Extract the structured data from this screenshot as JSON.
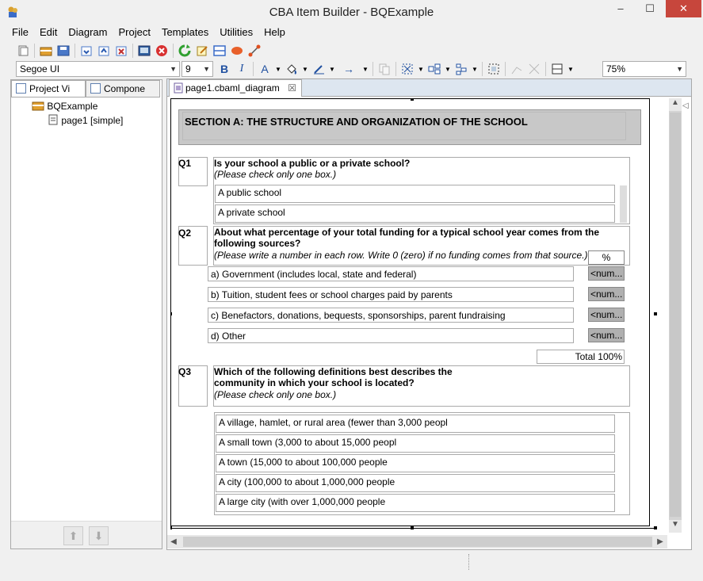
{
  "window": {
    "title": "CBA Item Builder - BQExample",
    "min": "–",
    "max": "☐",
    "close": "✕"
  },
  "menu": [
    "File",
    "Edit",
    "Diagram",
    "Project",
    "Templates",
    "Utilities",
    "Help"
  ],
  "toolbar": {
    "font": "Segoe UI",
    "size": "9",
    "bold": "B",
    "italic": "I",
    "font_color": "A",
    "arrow": "→",
    "zoom": "75%"
  },
  "left_panel": {
    "tabs": [
      "Project Vi",
      "Compone"
    ],
    "tree": {
      "project": "BQExample",
      "page": "page1 [simple]"
    }
  },
  "editor": {
    "tab": "page1.cbaml_diagram"
  },
  "form": {
    "section_title": "SECTION A: THE STRUCTURE AND ORGANIZATION OF THE SCHOOL",
    "q1": {
      "num": "Q1",
      "text": "Is your school a public or a private school?",
      "hint": "(Please check only one box.)",
      "options": [
        "A public school",
        "A private school"
      ]
    },
    "q2": {
      "num": "Q2",
      "text_line1": "About what percentage of your total funding for a typical school year comes from the",
      "text_line2": "following sources?",
      "hint": "(Please write a number in each row. Write 0 (zero) if no funding comes from that source.)",
      "unit": "%",
      "rows": [
        "a) Government (includes local, state and federal)",
        "b) Tuition, student fees or school charges paid by parents",
        "c) Benefactors, donations, bequests, sponsorships, parent fundraising",
        "d) Other"
      ],
      "num_placeholder": "<num...",
      "total": "Total 100%"
    },
    "q3": {
      "num": "Q3",
      "text_line1": "Which of the following definitions best describes the",
      "text_line2": "community in which your school is located?",
      "hint": "(Please check only one box.)",
      "options": [
        "A village, hamlet, or rural area (fewer than 3,000 peopl",
        "A small town (3,000 to about 15,000 peopl",
        "A town (15,000 to about 100,000 people",
        "A city (100,000 to about 1,000,000 people",
        "A large city (with over 1,000,000 people"
      ]
    }
  }
}
